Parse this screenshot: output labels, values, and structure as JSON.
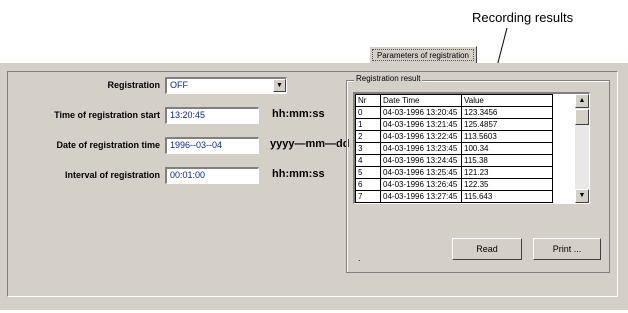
{
  "annotation": {
    "text": "Recording results"
  },
  "tab": {
    "label": "Parameters of registration"
  },
  "form": {
    "registration": {
      "label": "Registration",
      "value": "OFF"
    },
    "start_time": {
      "label": "Time of registration start",
      "value": "13:20:45",
      "unit": "hh:mm:ss"
    },
    "start_date": {
      "label": "Date of registration time",
      "value": "1996--03--04",
      "unit": "yyyy—mm—dd"
    },
    "interval": {
      "label": "Interval of registration",
      "value": "00:01:00",
      "unit": "hh:mm:ss"
    }
  },
  "result": {
    "title": "Registration result",
    "columns": [
      "Nr",
      "Date Time",
      "Value"
    ],
    "rows": [
      [
        "0",
        "04-03-1996   13:20:45",
        "123.3456"
      ],
      [
        "1",
        "04-03-1996   13:21:45",
        "125.4857"
      ],
      [
        "2",
        "04-03-1996   13:22:45",
        "113.5603"
      ],
      [
        "3",
        "04-03-1996   13:23:45",
        "100.34"
      ],
      [
        "4",
        "04-03-1996   13:24:45",
        "115.38"
      ],
      [
        "5",
        "04-03-1996   13:25:45",
        "121.23"
      ],
      [
        "6",
        "04-03-1996   13:26:45",
        "122.35"
      ],
      [
        "7",
        "04-03-1996   13:27:45",
        "115.643"
      ]
    ],
    "read_label": "Read",
    "print_label": "Print ...",
    "dot": "."
  },
  "icons": {
    "dropdown": "chevron-down-icon",
    "scroll_up": "arrow-up-icon",
    "scroll_down": "arrow-down-icon"
  }
}
